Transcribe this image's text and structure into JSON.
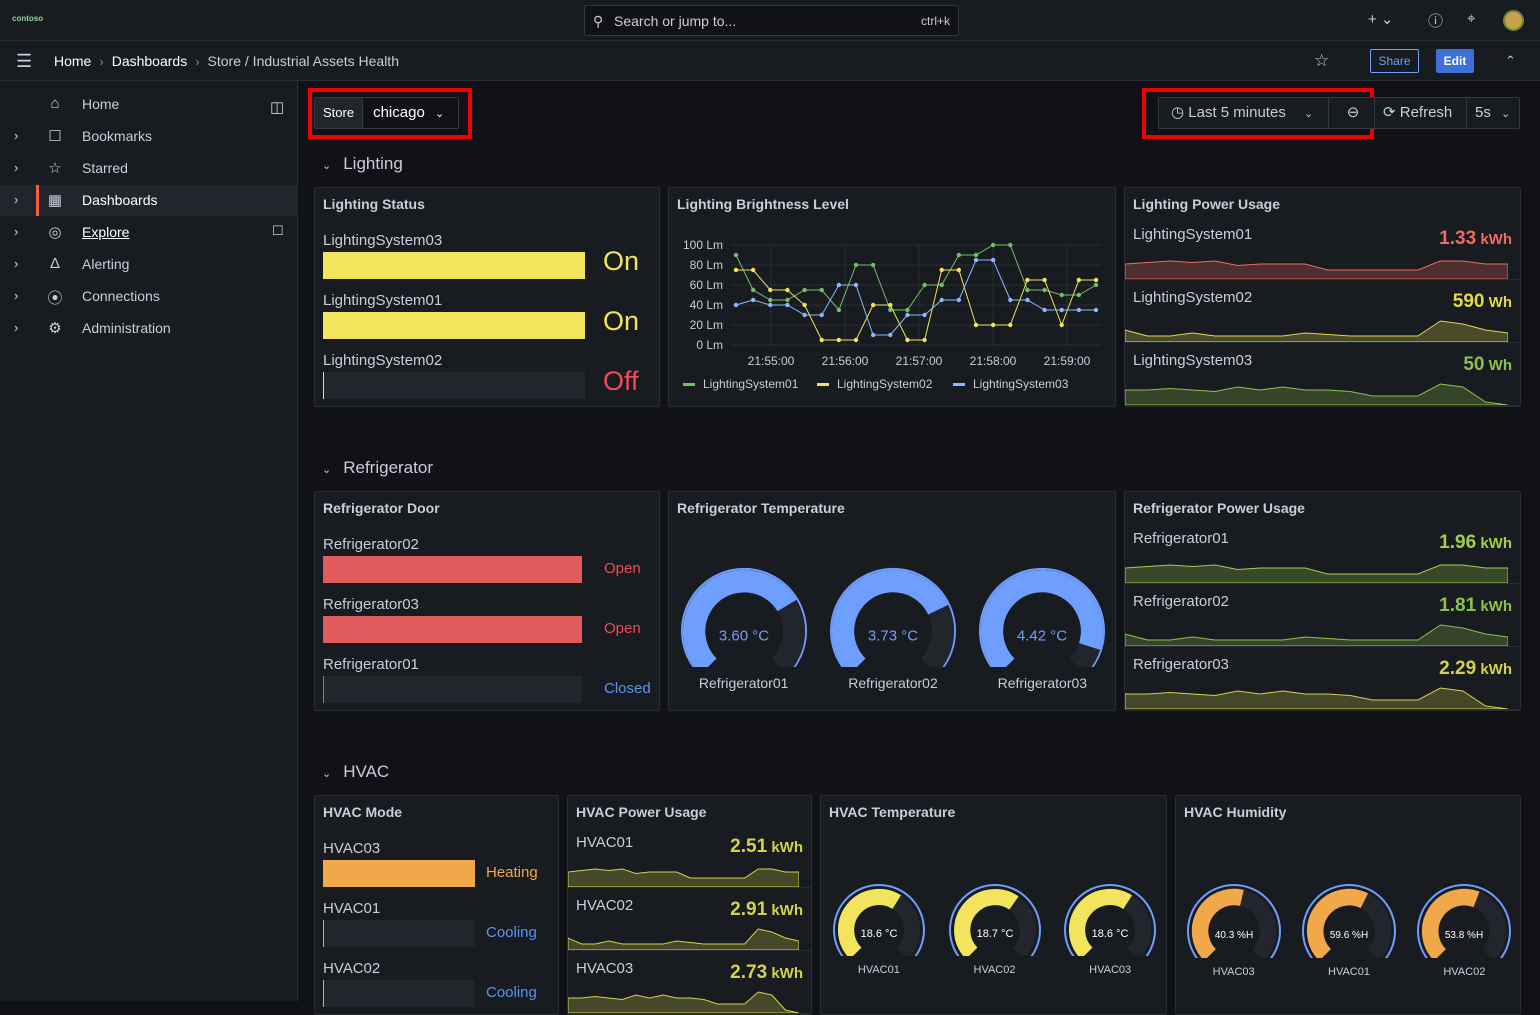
{
  "topbar": {
    "logo": "contoso",
    "search_placeholder": "Search or jump to...",
    "search_shortcut": "ctrl+k",
    "add_label": "+"
  },
  "breadcrumb": {
    "home": "Home",
    "dashboards": "Dashboards",
    "current": "Store / Industrial Assets Health",
    "share": "Share",
    "edit": "Edit"
  },
  "sidebar": {
    "items": [
      {
        "label": "Home",
        "icon": "home-icon"
      },
      {
        "label": "Bookmarks",
        "icon": "bookmark-icon"
      },
      {
        "label": "Starred",
        "icon": "star-icon"
      },
      {
        "label": "Dashboards",
        "icon": "grid-icon"
      },
      {
        "label": "Explore",
        "icon": "compass-icon"
      },
      {
        "label": "Alerting",
        "icon": "bell-icon"
      },
      {
        "label": "Connections",
        "icon": "plug-icon"
      },
      {
        "label": "Administration",
        "icon": "cog-icon"
      }
    ]
  },
  "controls": {
    "store_label": "Store",
    "store_value": "chicago",
    "time_range": "Last 5 minutes",
    "refresh": "Refresh",
    "interval": "5s"
  },
  "rows": {
    "lighting": "Lighting",
    "refrigerator": "Refrigerator",
    "hvac": "HVAC"
  },
  "lighting_status": {
    "title": "Lighting Status",
    "items": [
      {
        "name": "LightingSystem03",
        "state": "On",
        "level": 1
      },
      {
        "name": "LightingSystem01",
        "state": "On",
        "level": 1
      },
      {
        "name": "LightingSystem02",
        "state": "Off",
        "level": 0
      }
    ]
  },
  "brightness": {
    "title": "Lighting Brightness Level",
    "yticks": [
      "100 Lm",
      "80 Lm",
      "60 Lm",
      "40 Lm",
      "20 Lm",
      "0 Lm"
    ],
    "xticks": [
      "21:55:00",
      "21:56:00",
      "21:57:00",
      "21:58:00",
      "21:59:00"
    ],
    "legend": [
      "LightingSystem01",
      "LightingSystem02",
      "LightingSystem03"
    ]
  },
  "lighting_power": {
    "title": "Lighting Power Usage",
    "items": [
      {
        "name": "LightingSystem01",
        "value": "1.33",
        "unit": "kWh",
        "color": "#f2695e"
      },
      {
        "name": "LightingSystem02",
        "value": "590",
        "unit": "Wh",
        "color": "#e5d64c"
      },
      {
        "name": "LightingSystem03",
        "value": "50",
        "unit": "Wh",
        "color": "#8bc34a"
      }
    ]
  },
  "fridge_door": {
    "title": "Refrigerator Door",
    "items": [
      {
        "name": "Refrigerator02",
        "state": "Open",
        "level": 1
      },
      {
        "name": "Refrigerator03",
        "state": "Open",
        "level": 1
      },
      {
        "name": "Refrigerator01",
        "state": "Closed",
        "level": 0
      }
    ]
  },
  "fridge_temp": {
    "title": "Refrigerator Temperature",
    "gauges": [
      {
        "name": "Refrigerator01",
        "value": "3.60 °C",
        "fraction": 0.72
      },
      {
        "name": "Refrigerator02",
        "value": "3.73 °C",
        "fraction": 0.74
      },
      {
        "name": "Refrigerator03",
        "value": "4.42 °C",
        "fraction": 0.9
      }
    ]
  },
  "fridge_power": {
    "title": "Refrigerator Power Usage",
    "items": [
      {
        "name": "Refrigerator01",
        "value": "1.96",
        "unit": "kWh",
        "color": "#a0d04a"
      },
      {
        "name": "Refrigerator02",
        "value": "1.81",
        "unit": "kWh",
        "color": "#8bc34a"
      },
      {
        "name": "Refrigerator03",
        "value": "2.29",
        "unit": "kWh",
        "color": "#d4d14a"
      }
    ]
  },
  "hvac_mode": {
    "title": "HVAC Mode",
    "items": [
      {
        "name": "HVAC03",
        "state": "Heating",
        "level": 1
      },
      {
        "name": "HVAC01",
        "state": "Cooling",
        "level": 0
      },
      {
        "name": "HVAC02",
        "state": "Cooling",
        "level": 0
      }
    ]
  },
  "hvac_power": {
    "title": "HVAC Power Usage",
    "items": [
      {
        "name": "HVAC01",
        "value": "2.51",
        "unit": "kWh"
      },
      {
        "name": "HVAC02",
        "value": "2.91",
        "unit": "kWh"
      },
      {
        "name": "HVAC03",
        "value": "2.73",
        "unit": "kWh"
      }
    ]
  },
  "hvac_temp": {
    "title": "HVAC Temperature",
    "gauges": [
      {
        "name": "HVAC01",
        "value": "18.6 °C",
        "fraction": 0.62
      },
      {
        "name": "HVAC02",
        "value": "18.7 °C",
        "fraction": 0.63
      },
      {
        "name": "HVAC03",
        "value": "18.6 °C",
        "fraction": 0.62
      }
    ]
  },
  "hvac_hum": {
    "title": "HVAC Humidity",
    "gauges": [
      {
        "name": "HVAC03",
        "value": "40.3 %H",
        "fraction": 0.55
      },
      {
        "name": "HVAC01",
        "value": "59.6 %H",
        "fraction": 0.6
      },
      {
        "name": "HVAC02",
        "value": "53.8 %H",
        "fraction": 0.58
      }
    ]
  },
  "colors": {
    "on": "#f2e45c",
    "off_text": "#f2495c",
    "open": "#e05c5c",
    "closed_text": "#5794f2",
    "heating": "#f0a84a",
    "cool_text": "#5794f2",
    "gauge_blue": "#6e9fff",
    "gauge_yellow": "#f2e45c",
    "gauge_orange": "#f0a84a"
  }
}
